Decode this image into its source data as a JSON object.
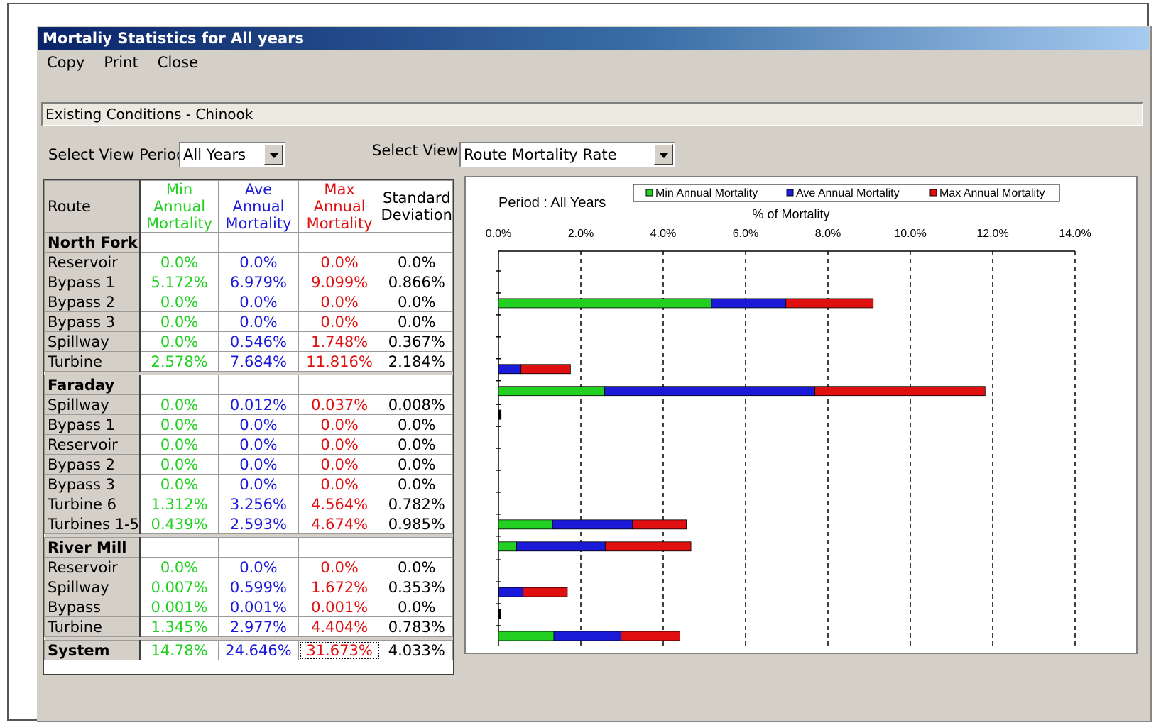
{
  "window": {
    "title": "Mortaliy Statistics for All years"
  },
  "menu": {
    "copy": "Copy",
    "print": "Print",
    "close": "Close"
  },
  "scenario": "Existing Conditions - Chinook",
  "controls": {
    "period_label": "Select View Period:",
    "period_value": "All Years",
    "view_label": "Select View:",
    "view_value": "Route Mortality Rate"
  },
  "table": {
    "headers": {
      "route": "Route",
      "min": "Min Annual Mortality",
      "ave": "Ave Annual Mortality",
      "max": "Max Annual Mortality",
      "std": "Standard Deviation"
    },
    "groups": [
      {
        "name": "North Fork",
        "rows": [
          {
            "route": "Reservoir",
            "min": "0.0%",
            "ave": "0.0%",
            "max": "0.0%",
            "std": "0.0%"
          },
          {
            "route": "Bypass 1",
            "min": "5.172%",
            "ave": "6.979%",
            "max": "9.099%",
            "std": "0.866%"
          },
          {
            "route": "Bypass 2",
            "min": "0.0%",
            "ave": "0.0%",
            "max": "0.0%",
            "std": "0.0%"
          },
          {
            "route": "Bypass 3",
            "min": "0.0%",
            "ave": "0.0%",
            "max": "0.0%",
            "std": "0.0%"
          },
          {
            "route": "Spillway",
            "min": "0.0%",
            "ave": "0.546%",
            "max": "1.748%",
            "std": "0.367%"
          },
          {
            "route": "Turbine",
            "min": "2.578%",
            "ave": "7.684%",
            "max": "11.816%",
            "std": "2.184%"
          }
        ]
      },
      {
        "name": "Faraday",
        "rows": [
          {
            "route": "Spillway",
            "min": "0.0%",
            "ave": "0.012%",
            "max": "0.037%",
            "std": "0.008%"
          },
          {
            "route": "Bypass 1",
            "min": "0.0%",
            "ave": "0.0%",
            "max": "0.0%",
            "std": "0.0%"
          },
          {
            "route": "Reservoir",
            "min": "0.0%",
            "ave": "0.0%",
            "max": "0.0%",
            "std": "0.0%"
          },
          {
            "route": "Bypass 2",
            "min": "0.0%",
            "ave": "0.0%",
            "max": "0.0%",
            "std": "0.0%"
          },
          {
            "route": "Bypass 3",
            "min": "0.0%",
            "ave": "0.0%",
            "max": "0.0%",
            "std": "0.0%"
          },
          {
            "route": "Turbine 6",
            "min": "1.312%",
            "ave": "3.256%",
            "max": "4.564%",
            "std": "0.782%"
          },
          {
            "route": "Turbines 1-5",
            "min": "0.439%",
            "ave": "2.593%",
            "max": "4.674%",
            "std": "0.985%"
          }
        ]
      },
      {
        "name": "River Mill",
        "rows": [
          {
            "route": "Reservoir",
            "min": "0.0%",
            "ave": "0.0%",
            "max": "0.0%",
            "std": "0.0%"
          },
          {
            "route": "Spillway",
            "min": "0.007%",
            "ave": "0.599%",
            "max": "1.672%",
            "std": "0.353%"
          },
          {
            "route": "Bypass",
            "min": "0.001%",
            "ave": "0.001%",
            "max": "0.001%",
            "std": "0.0%"
          },
          {
            "route": "Turbine",
            "min": "1.345%",
            "ave": "2.977%",
            "max": "4.404%",
            "std": "0.783%"
          }
        ]
      }
    ],
    "system": {
      "route": "System",
      "min": "14.78%",
      "ave": "24.646%",
      "max": "31.673%",
      "std": "4.033%"
    }
  },
  "colors": {
    "min": "#22d022",
    "ave": "#1a1ad8",
    "max": "#e01010"
  },
  "chart_data": {
    "type": "bar",
    "orientation": "horizontal",
    "stacked": true,
    "title": "Period : All Years",
    "xlabel": "% of Mortality",
    "xlim": [
      0,
      14
    ],
    "ticks": [
      "0.0%",
      "2.0%",
      "4.0%",
      "6.0%",
      "8.0%",
      "10.0%",
      "12.0%",
      "14.0%"
    ],
    "grid": true,
    "legend_position": "top",
    "series": [
      {
        "name": "Min Annual Mortality",
        "color": "#22d022",
        "values": [
          0.0,
          5.172,
          0.0,
          0.0,
          0.0,
          2.578,
          0.0,
          0.0,
          0.0,
          0.0,
          0.0,
          1.312,
          0.439,
          0.0,
          0.007,
          0.001,
          1.345
        ]
      },
      {
        "name": "Ave Annual Mortality",
        "color": "#1a1ad8",
        "values": [
          0.0,
          6.979,
          0.0,
          0.0,
          0.546,
          7.684,
          0.012,
          0.0,
          0.0,
          0.0,
          0.0,
          3.256,
          2.593,
          0.0,
          0.599,
          0.001,
          2.977
        ]
      },
      {
        "name": "Max Annual Mortality",
        "color": "#e01010",
        "values": [
          0.0,
          9.099,
          0.0,
          0.0,
          1.748,
          11.816,
          0.037,
          0.0,
          0.0,
          0.0,
          0.0,
          4.564,
          4.674,
          0.0,
          1.672,
          0.001,
          4.404
        ]
      }
    ]
  }
}
